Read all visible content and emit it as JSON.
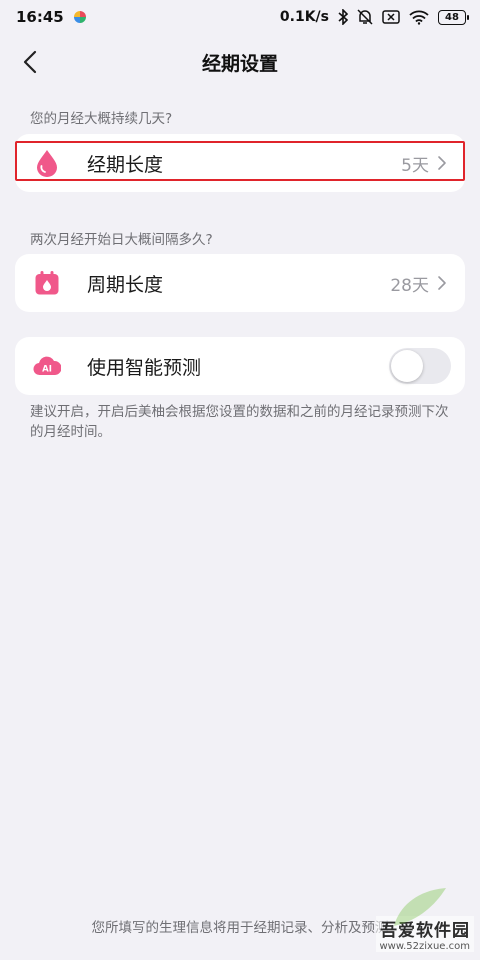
{
  "status_bar": {
    "time": "16:45",
    "network_speed": "0.1K/s",
    "battery": "48",
    "icons": [
      "app-notification-icon",
      "bluetooth-icon",
      "mute-icon",
      "sim-disabled-icon",
      "wifi-icon",
      "battery-icon"
    ]
  },
  "header": {
    "title": "经期设置"
  },
  "period_section": {
    "question": "您的月经大概持续几天?",
    "label": "经期长度",
    "value": "5天",
    "icon": "drop-icon"
  },
  "cycle_section": {
    "question": "两次月经开始日大概间隔多久?",
    "label": "周期长度",
    "value": "28天",
    "icon": "calendar-drop-icon"
  },
  "prediction": {
    "label": "使用智能预测",
    "icon_text": "AI",
    "enabled": false,
    "note": "建议开启，开启后美柚会根据您设置的数据和之前的月经记录预测下次的月经时间。"
  },
  "footer": {
    "text": "您所填写的生理信息将用于经期记录、分析及预测"
  },
  "watermark": {
    "brand": "吾爱软件园",
    "url": "www.52zixue.com"
  },
  "colors": {
    "accent_pink": "#f0588a",
    "highlight_red": "#e0242b",
    "background": "#f2f1f6"
  }
}
